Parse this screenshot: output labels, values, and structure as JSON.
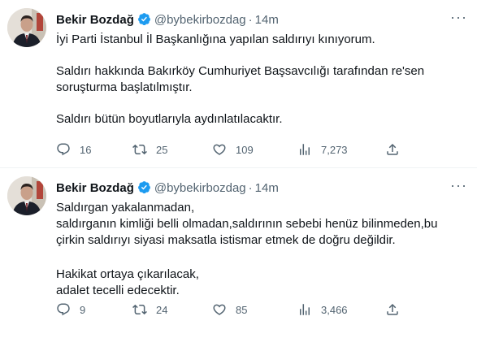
{
  "tweets": [
    {
      "author": {
        "name": "Bekir Bozdağ",
        "handle": "@bybekirbozdag",
        "verified": true
      },
      "separator": "·",
      "time": "14m",
      "text": [
        "İyi Parti İstanbul İl Başkanlığına yapılan saldırıyı kınıyorum.",
        "Saldırı hakkında Bakırköy Cumhuriyet Başsavcılığı tarafından re'sen\nsoruşturma başlatılmıştır.",
        "Saldırı bütün boyutlarıyla aydınlatılacaktır."
      ],
      "stats": {
        "replies": "16",
        "retweets": "25",
        "likes": "109",
        "views": "7,273"
      }
    },
    {
      "author": {
        "name": "Bekir Bozdağ",
        "handle": "@bybekirbozdag",
        "verified": true
      },
      "separator": "·",
      "time": "14m",
      "text": [
        "Saldırgan yakalanmadan,\nsaldırganın kimliği belli olmadan,saldırının sebebi henüz bilinmeden,bu\nçirkin saldırıyı siyasi maksatla istismar etmek de doğru değildir.",
        "Hakikat ortaya çıkarılacak,\nadalet tecelli edecektir."
      ],
      "stats": {
        "replies": "9",
        "retweets": "24",
        "likes": "85",
        "views": "3,466"
      }
    }
  ],
  "icons": {
    "more": "more-icon",
    "verified": "verified-badge-icon",
    "reply": "reply-icon",
    "retweet": "retweet-icon",
    "like": "like-icon",
    "views": "views-icon",
    "share": "share-icon"
  },
  "colors": {
    "text": "#0f1419",
    "secondary": "#536471",
    "verified": "#1d9bf0",
    "divider": "#eff3f4"
  }
}
